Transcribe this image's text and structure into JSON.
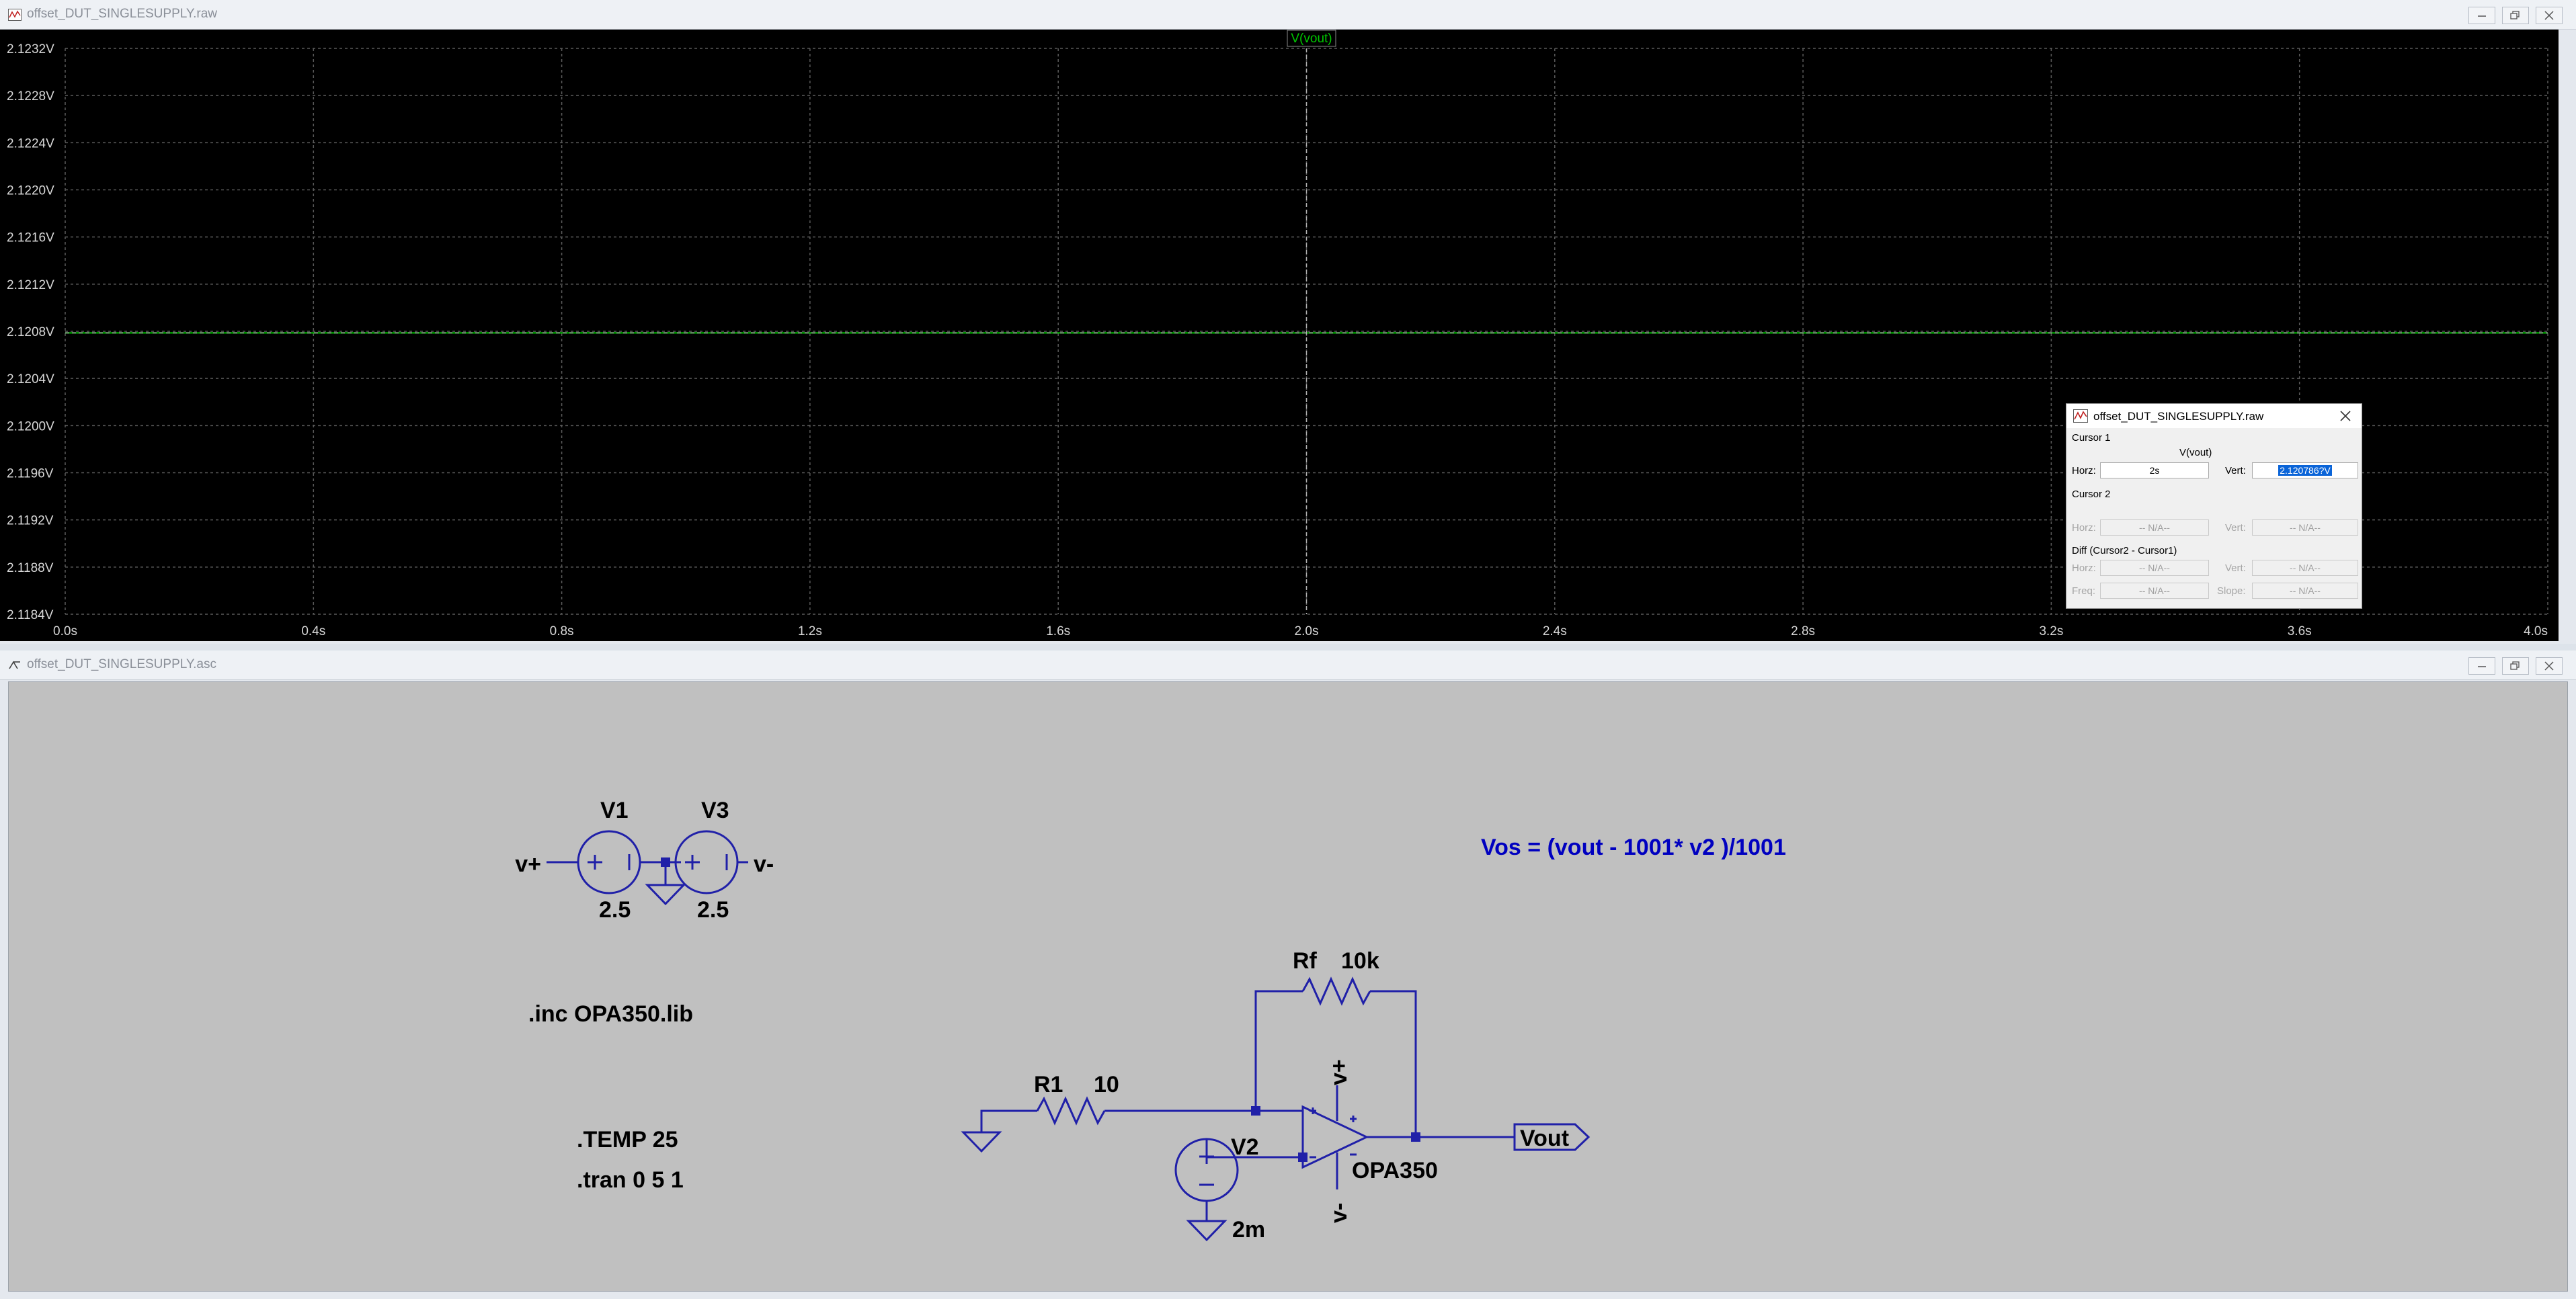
{
  "plot_window": {
    "title": "offset_DUT_SINGLESUPPLY.raw",
    "trace_label": "V(vout)",
    "colors": {
      "background": "#000000",
      "grid": "#5a5a5a",
      "trace": "#00c800",
      "axis_text": "#d8d8d8"
    }
  },
  "chart_data": {
    "type": "line",
    "series": [
      {
        "name": "V(vout)",
        "x": [
          0,
          4.0
        ],
        "y": [
          2.1207862,
          2.1207862
        ]
      }
    ],
    "x_ticks": [
      "0.0s",
      "0.4s",
      "0.8s",
      "1.2s",
      "1.6s",
      "2.0s",
      "2.4s",
      "2.8s",
      "3.2s",
      "3.6s",
      "4.0s"
    ],
    "y_ticks": [
      "2.1232V",
      "2.1228V",
      "2.1224V",
      "2.1220V",
      "2.1216V",
      "2.1212V",
      "2.1208V",
      "2.1204V",
      "2.1200V",
      "2.1196V",
      "2.1192V",
      "2.1188V",
      "2.1184V"
    ],
    "xlim": [
      0,
      4.0
    ],
    "ylim": [
      2.1184,
      2.1232
    ],
    "grid": true
  },
  "cursor_dialog": {
    "title": "offset_DUT_SINGLESUPPLY.raw",
    "cursor1_label": "Cursor 1",
    "trace_name": "V(vout)",
    "horz_label": "Horz:",
    "horz_value": "2s",
    "vert_label": "Vert:",
    "vert_value": "2.120786?V",
    "cursor2_label": "Cursor 2",
    "c2_horz_label": "Horz:",
    "c2_horz_value": "-- N/A--",
    "c2_vert_label": "Vert:",
    "c2_vert_value": "-- N/A--",
    "diff_label": "Diff (Cursor2 - Cursor1)",
    "d_horz_label": "Horz:",
    "d_horz_value": "-- N/A--",
    "d_vert_label": "Vert:",
    "d_vert_value": "-- N/A--",
    "freq_label": "Freq:",
    "freq_value": "-- N/A--",
    "slope_label": "Slope:",
    "slope_value": "-- N/A--"
  },
  "schematic_window": {
    "title": "offset_DUT_SINGLESUPPLY.asc",
    "colors": {
      "background": "#c0c0c0",
      "wire": "#2020a8",
      "text": "#000000",
      "comment": "#0000c0"
    }
  },
  "schematic": {
    "v1_name": "V1",
    "v1_value": "2.5",
    "v3_name": "V3",
    "v3_value": "2.5",
    "vplus_net": "v+",
    "vminus_net": "v-",
    "inc_directive": ".inc OPA350.lib",
    "temp_directive": ".TEMP 25",
    "tran_directive": ".tran 0 5 1",
    "formula": "Vos = (vout - 1001* v2 )/1001",
    "rf_name": "Rf",
    "rf_value": "10k",
    "r1_name": "R1",
    "r1_value": "10",
    "v2_name": "V2",
    "v2_value": "2m",
    "opamp_name": "OPA350",
    "opamp_vplus": "v+",
    "opamp_vminus": "v-",
    "vout_label": "Vout"
  }
}
